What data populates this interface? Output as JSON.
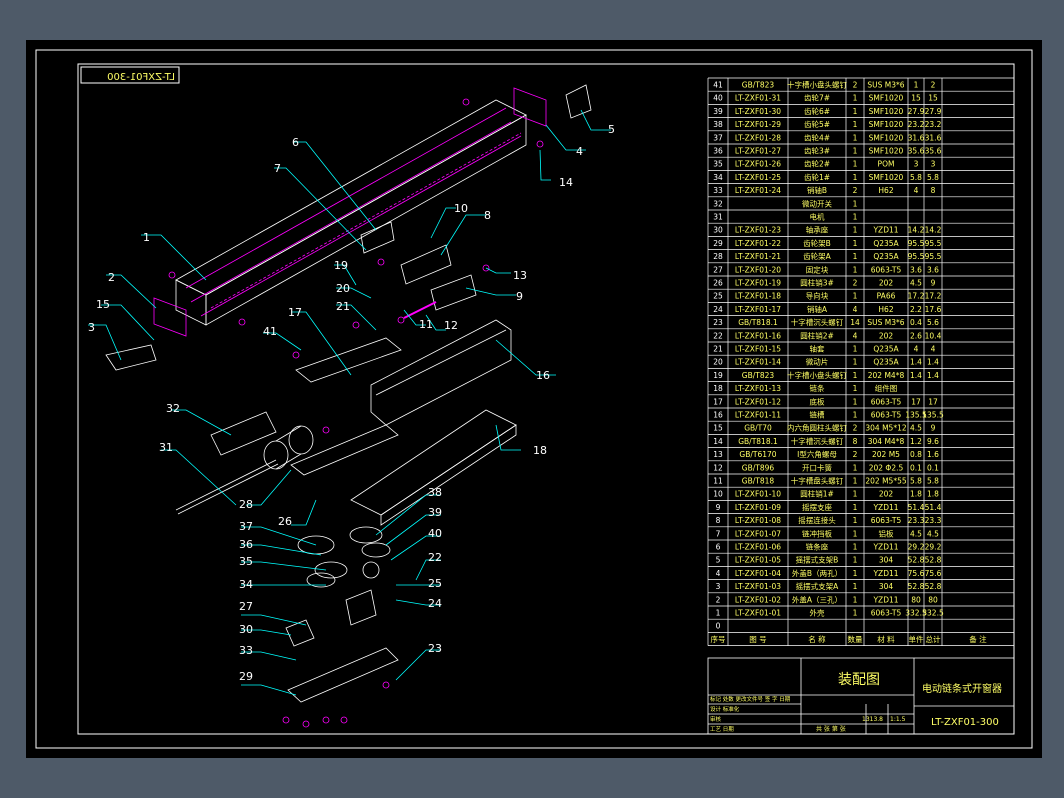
{
  "title_block": {
    "drawing_type": "装配图",
    "product_name": "电动链条式开窗器",
    "drawing_no": "LT-ZXF01-300",
    "mirrored_drawing_no": "LT-ZXF01-300",
    "scale_label": "比例",
    "scale": "1:1.5",
    "weight": "1313.8",
    "sheet": "共 张 第 张",
    "rows": [
      "标记 处数 更改文件号 签 字 日期",
      "设计 标准化",
      "审核",
      "工艺 日期"
    ]
  },
  "bom": {
    "header": [
      "序号",
      "图 号",
      "名 称",
      "数量",
      "材 料",
      "单件",
      "总计",
      "备 注"
    ],
    "header_weight": "重量(g)",
    "rows": [
      [
        "41",
        "GB/T823",
        "十字槽小盘头螺钉",
        "2",
        "SUS M3*6",
        "1",
        "2"
      ],
      [
        "40",
        "LT-ZXF01-31",
        "齿轮7#",
        "1",
        "SMF1020",
        "15",
        "15"
      ],
      [
        "39",
        "LT-ZXF01-30",
        "齿轮6#",
        "1",
        "SMF1020",
        "27.9",
        "27.9"
      ],
      [
        "38",
        "LT-ZXF01-29",
        "齿轮5#",
        "1",
        "SMF1020",
        "23.2",
        "23.2"
      ],
      [
        "37",
        "LT-ZXF01-28",
        "齿轮4#",
        "1",
        "SMF1020",
        "31.6",
        "31.6"
      ],
      [
        "36",
        "LT-ZXF01-27",
        "齿轮3#",
        "1",
        "SMF1020",
        "35.6",
        "35.6"
      ],
      [
        "35",
        "LT-ZXF01-26",
        "齿轮2#",
        "1",
        "POM",
        "3",
        "3"
      ],
      [
        "34",
        "LT-ZXF01-25",
        "齿轮1#",
        "1",
        "SMF1020",
        "5.8",
        "5.8"
      ],
      [
        "33",
        "LT-ZXF01-24",
        "销轴B",
        "2",
        "H62",
        "4",
        "8"
      ],
      [
        "32",
        "",
        "微动开关",
        "1",
        "",
        "",
        ""
      ],
      [
        "31",
        "",
        "电机",
        "1",
        "",
        "",
        ""
      ],
      [
        "30",
        "LT-ZXF01-23",
        "轴承座",
        "1",
        "YZD11",
        "14.2",
        "14.2"
      ],
      [
        "29",
        "LT-ZXF01-22",
        "齿轮架B",
        "1",
        "Q235A",
        "95.5",
        "95.5"
      ],
      [
        "28",
        "LT-ZXF01-21",
        "齿轮架A",
        "1",
        "Q235A",
        "95.5",
        "95.5"
      ],
      [
        "27",
        "LT-ZXF01-20",
        "固定块",
        "1",
        "6063-T5",
        "3.6",
        "3.6"
      ],
      [
        "26",
        "LT-ZXF01-19",
        "圆柱销3#",
        "2",
        "202",
        "4.5",
        "9"
      ],
      [
        "25",
        "LT-ZXF01-18",
        "导向块",
        "1",
        "PA66",
        "17.2",
        "17.2"
      ],
      [
        "24",
        "LT-ZXF01-17",
        "销轴A",
        "4",
        "H62",
        "2.2",
        "17.6"
      ],
      [
        "23",
        "GB/T818.1",
        "十字槽沉头螺钉",
        "14",
        "SUS M3*6",
        "0.4",
        "5.6"
      ],
      [
        "22",
        "LT-ZXF01-16",
        "圆柱销2#",
        "4",
        "202",
        "2.6",
        "10.4"
      ],
      [
        "21",
        "LT-ZXF01-15",
        "轴套",
        "1",
        "Q235A",
        "4",
        "4"
      ],
      [
        "20",
        "LT-ZXF01-14",
        "微动片",
        "1",
        "Q235A",
        "1.4",
        "1.4"
      ],
      [
        "19",
        "GB/T823",
        "十字槽小盘头螺钉",
        "1",
        "202 M4*8",
        "1.4",
        "1.4"
      ],
      [
        "18",
        "LT-ZXF01-13",
        "链条",
        "1",
        "组件图",
        "",
        ""
      ],
      [
        "17",
        "LT-ZXF01-12",
        "底板",
        "1",
        "6063-T5",
        "17",
        "17"
      ],
      [
        "16",
        "LT-ZXF01-11",
        "链槽",
        "1",
        "6063-T5",
        "135.5",
        "135.5"
      ],
      [
        "15",
        "GB/T70",
        "内六角圆柱头螺钉",
        "2",
        "304 M5*12",
        "4.5",
        "9"
      ],
      [
        "14",
        "GB/T818.1",
        "十字槽沉头螺钉",
        "8",
        "304 M4*8",
        "1.2",
        "9.6"
      ],
      [
        "13",
        "GB/T6170",
        "I型六角螺母",
        "2",
        "202 M5",
        "0.8",
        "1.6"
      ],
      [
        "12",
        "GB/T896",
        "开口卡簧",
        "1",
        "202 Φ2.5",
        "0.1",
        "0.1"
      ],
      [
        "11",
        "GB/T818",
        "十字槽盘头螺钉",
        "1",
        "202 M5*55",
        "5.8",
        "5.8"
      ],
      [
        "10",
        "LT-ZXF01-10",
        "圆柱销1#",
        "1",
        "202",
        "1.8",
        "1.8"
      ],
      [
        "9",
        "LT-ZXF01-09",
        "摇摆支座",
        "1",
        "YZD11",
        "51.4",
        "51.4"
      ],
      [
        "8",
        "LT-ZXF01-08",
        "摇摆连接头",
        "1",
        "6063-T5",
        "23.3",
        "23.3"
      ],
      [
        "7",
        "LT-ZXF01-07",
        "链冲挡板",
        "1",
        "铝板",
        "4.5",
        "4.5"
      ],
      [
        "6",
        "LT-ZXF01-06",
        "链条座",
        "1",
        "YZD11",
        "29.2",
        "29.2"
      ],
      [
        "5",
        "LT-ZXF01-05",
        "摇摆式支架B",
        "1",
        "304",
        "52.8",
        "52.8"
      ],
      [
        "4",
        "LT-ZXF01-04",
        "外盖B（两孔）",
        "1",
        "YZD11",
        "75.6",
        "75.6"
      ],
      [
        "3",
        "LT-ZXF01-03",
        "摇摆式支架A",
        "1",
        "304",
        "52.8",
        "52.8"
      ],
      [
        "2",
        "LT-ZXF01-02",
        "外盖A（三孔）",
        "1",
        "YZD11",
        "80",
        "80"
      ],
      [
        "1",
        "LT-ZXF01-01",
        "外壳",
        "1",
        "6063-T5",
        "332.5",
        "332.5"
      ],
      [
        "0",
        "",
        "",
        "",
        "",
        "",
        ""
      ]
    ]
  },
  "callouts": [
    "1",
    "2",
    "3",
    "4",
    "5",
    "6",
    "7",
    "8",
    "9",
    "10",
    "11",
    "12",
    "13",
    "14",
    "15",
    "16",
    "17",
    "18",
    "19",
    "20",
    "21",
    "22",
    "23",
    "24",
    "25",
    "26",
    "27",
    "28",
    "29",
    "30",
    "31",
    "32",
    "33",
    "34",
    "35",
    "36",
    "37",
    "38",
    "39",
    "40",
    "41"
  ],
  "colors": {
    "background": "#4e5a68",
    "sheet": "#000000",
    "frame": "#ffffff",
    "table_line": "#ffffff",
    "table_text": "#ffff66",
    "leader": "#00ffff",
    "part_outline": "#ffffff",
    "part_hidden": "#ff00ff"
  }
}
